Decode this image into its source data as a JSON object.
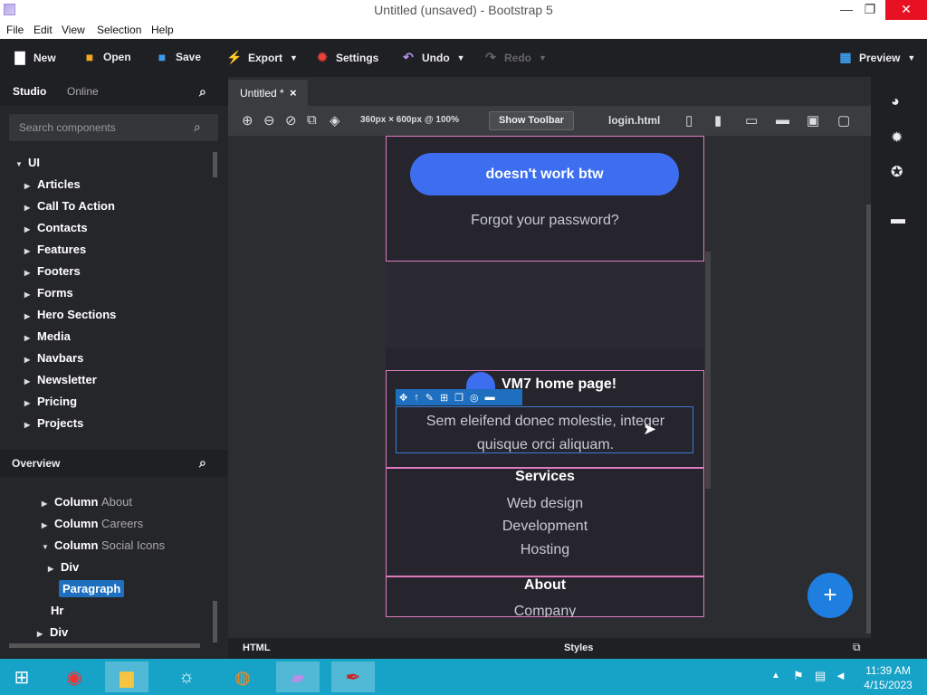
{
  "window": {
    "title": "Untitled (unsaved) - Bootstrap 5",
    "minimize": "—",
    "maximize": "❐",
    "close": "✕"
  },
  "menu": [
    "File",
    "Edit",
    "View",
    "Selection",
    "Help"
  ],
  "toolbar": {
    "new": "New",
    "open": "Open",
    "save": "Save",
    "export": "Export",
    "settings": "Settings",
    "undo": "Undo",
    "redo": "Redo",
    "preview": "Preview"
  },
  "left_tabs": {
    "studio": "Studio",
    "online": "Online"
  },
  "search_placeholder": "Search components",
  "components": {
    "root": "UI",
    "items": [
      "Articles",
      "Call To Action",
      "Contacts",
      "Features",
      "Footers",
      "Forms",
      "Hero Sections",
      "Media",
      "Navbars",
      "Newsletter",
      "Pricing",
      "Projects"
    ]
  },
  "overview": {
    "title": "Overview",
    "nodes": [
      {
        "label": "Column",
        "sub": "About"
      },
      {
        "label": "Column",
        "sub": "Careers"
      },
      {
        "label": "Column",
        "sub": "Social Icons"
      },
      {
        "label": "Div",
        "sub": ""
      },
      {
        "label": "Paragraph",
        "sub": ""
      },
      {
        "label": "Hr",
        "sub": ""
      },
      {
        "label": "Div",
        "sub": ""
      }
    ]
  },
  "doc_tab": {
    "label": "Untitled *",
    "close": "×"
  },
  "canvas_toolbar": {
    "size_label": "360px × 600px @ 100%",
    "show_toolbar": "Show Toolbar",
    "file": "login.html"
  },
  "preview": {
    "button_text": "doesn't work btw",
    "forgot": "Forgot your password?",
    "home_heading": "VM7 home page!",
    "paragraph": "Sem eleifend donec molestie, integer quisque orci aliquam.",
    "services_heading": "Services",
    "services": [
      "Web design",
      "Development",
      "Hosting"
    ],
    "about_heading": "About",
    "about_first": "Company"
  },
  "bottom": {
    "html": "HTML",
    "styles": "Styles"
  },
  "taskbar": {
    "time": "11:39 AM",
    "date": "4/15/2023"
  },
  "colors": {
    "accent": "#3d6ef0",
    "fab": "#1e7fe0",
    "selection_border": "#e07ac0",
    "taskbar": "#17a2c7"
  }
}
